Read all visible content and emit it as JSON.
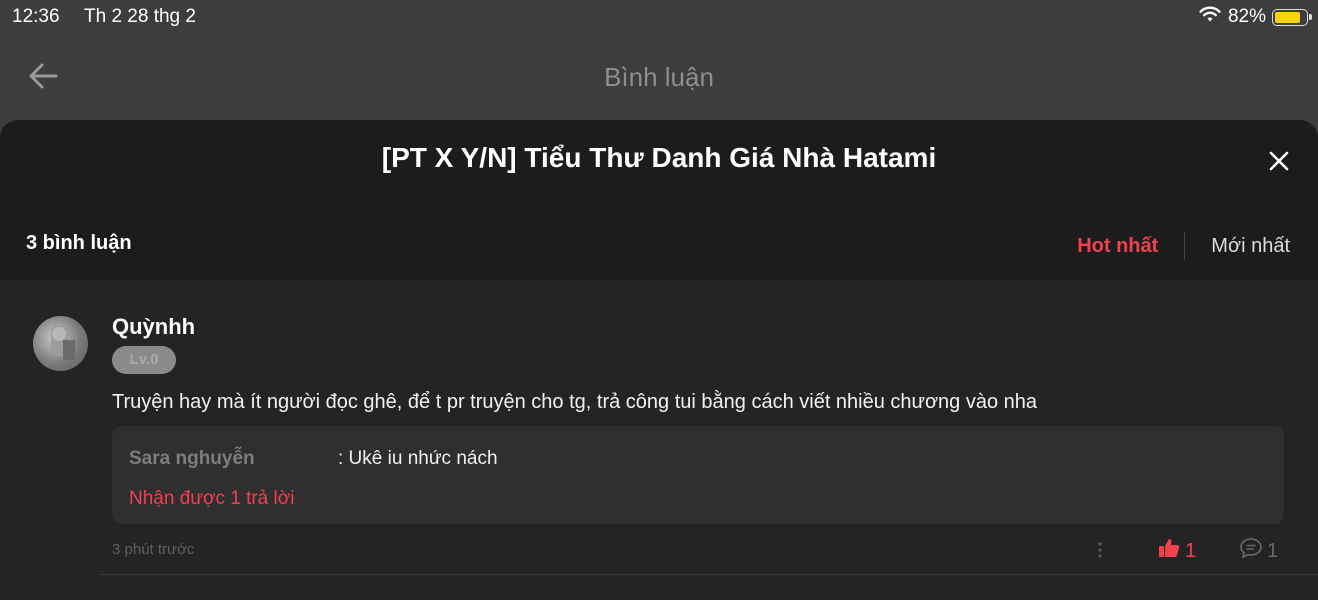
{
  "status_bar": {
    "time": "12:36",
    "date": "Th 2 28 thg 2",
    "battery_percent": "82%",
    "battery_level": 0.82,
    "icons": [
      "wifi-icon",
      "battery-icon"
    ]
  },
  "nav": {
    "title": "Bình luận",
    "back_icon": "arrow-left-icon"
  },
  "sheet": {
    "title": "[PT X Y/N] Tiểu Thư Danh Giá Nhà Hatami",
    "close_icon": "close-icon",
    "comment_count": "3 bình luận",
    "sort": {
      "hot": "Hot nhất",
      "newest": "Mới nhất",
      "active": "hot"
    }
  },
  "comments": [
    {
      "username": "Quỳnhh",
      "level": "Lv.0",
      "text": "Truyện hay mà ít người đọc ghê, để t pr truyện cho tg, trả công tui bằng cách viết nhiều chương vào nha",
      "reply_preview": {
        "name": "Sara nghuyễn",
        "text": ": Ukê iu nhức nách",
        "replies_received": "Nhận được 1 trả lời"
      },
      "time_ago": "3 phút trước",
      "likes": "1",
      "replies": "1"
    }
  ],
  "colors": {
    "accent": "#f2404d",
    "background": "#1c1c1e",
    "header": "#3d3d3d",
    "battery": "#f6d20f"
  }
}
